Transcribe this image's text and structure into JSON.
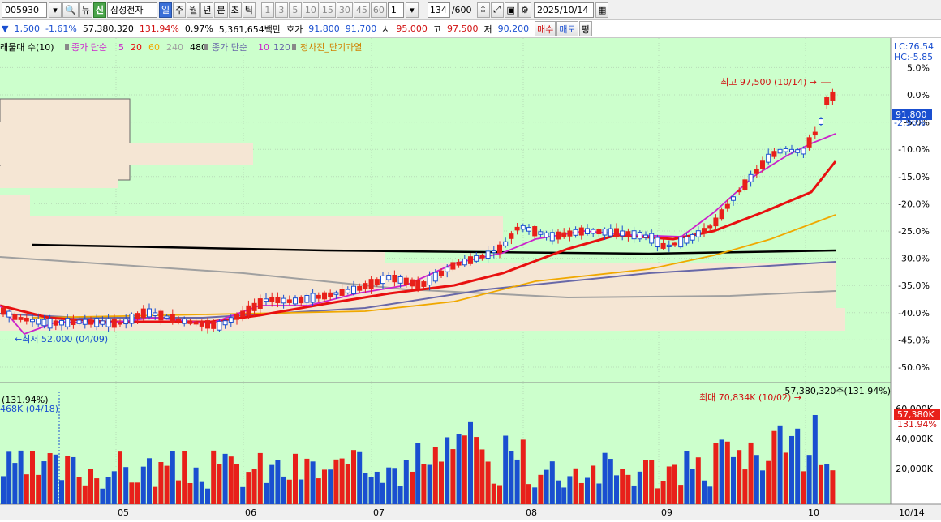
{
  "toolbar": {
    "code": "005930",
    "new_label": "뉴",
    "new_badge": "신",
    "stock_name": "삼성전자",
    "period_buttons": [
      "일",
      "주",
      "월",
      "년",
      "분",
      "초",
      "틱"
    ],
    "active_period": "일",
    "interval_buttons": [
      "1",
      "3",
      "5",
      "10",
      "15",
      "30",
      "45",
      "60"
    ],
    "interval_value": "1",
    "count": "134",
    "count_total": "/600",
    "date": "2025/10/14"
  },
  "quote": {
    "change": "1,500",
    "change_rate": "-1.61%",
    "volume": "57,380,320",
    "volume_rate": "131.94%",
    "turnover": "0.97%",
    "amount": "5,361,654백만",
    "ask_label": "호가",
    "ask": "91,800",
    "bid": "91,700",
    "open_label": "시",
    "open": "95,000",
    "high_label": "고",
    "high": "97,500",
    "low_label": "저",
    "low": "90,200",
    "buy_label": "매수",
    "sell_label": "매도",
    "avg_label": "평"
  },
  "legend": {
    "vol_label": "래물대 수(10)",
    "ma1_label": "종가 단순",
    "ma1_periods": [
      "5",
      "20",
      "60",
      "240",
      "480"
    ],
    "ma2_label": "종가 단순",
    "ma2_periods": [
      "10",
      "120"
    ],
    "extra_label": "청사진_단기과열"
  },
  "price_axis": {
    "lc": "LC:76.54",
    "hc": "HC:-5.85",
    "ticks": [
      "5.0%",
      "0.0%",
      "-5.0%",
      "-10.0%",
      "-15.0%",
      "-20.0%",
      "-25.0%",
      "-30.0%",
      "-35.0%",
      "-40.0%",
      "-45.0%",
      "-50.0%"
    ],
    "current_price": "91,800",
    "current_pct": "-2.96%"
  },
  "volume_axis": {
    "ticks": [
      "60,000K",
      "40,000K",
      "20,000K"
    ],
    "current": "57,380K",
    "current_pct": "131.94%"
  },
  "annotations": {
    "high": "최고 97,500 (10/14)",
    "low": "최저 52,000 (04/09)",
    "vol_max": "최대 70,834K (10/02)",
    "vol_total": "57,380,320주(131.94%)",
    "vol_left_pct": "(131.94%)",
    "vol_left_min": "468K (04/18)"
  },
  "x_labels": [
    "05",
    "06",
    "07",
    "08",
    "09",
    "10",
    "10/14"
  ],
  "colors": {
    "up": "#e8201a",
    "down": "#1a4fd0",
    "ma5": "#cc22cc",
    "ma20": "#e81010",
    "ma60": "#f0a800",
    "ma120": "#6868a8",
    "ma240": "#a0a0a0",
    "ma480": "#000000",
    "bg": "#ccffcc"
  },
  "chart_data": {
    "type": "candlestick",
    "y_axis": "percent",
    "ylim": [
      -50,
      5
    ],
    "high": 97500,
    "low": 52000,
    "vol_max": 70834,
    "unit_vol": "K"
  }
}
